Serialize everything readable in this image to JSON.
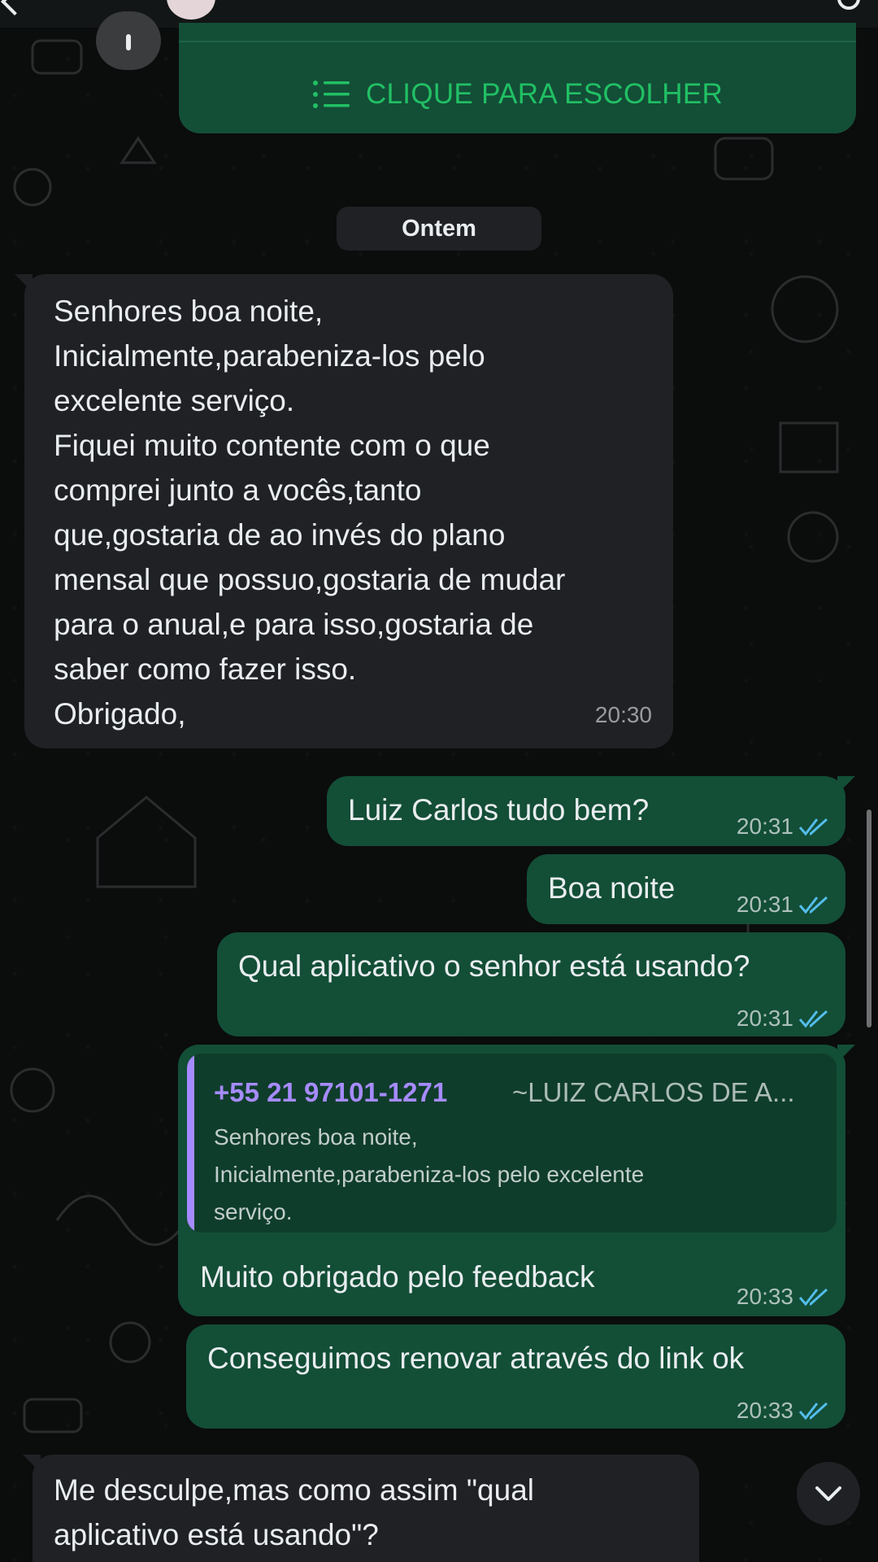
{
  "conversation": {
    "list_button_label": "CLIQUE PARA ESCOLHER",
    "date_divider": "Ontem",
    "messages": [
      {
        "direction": "incoming",
        "text": "Senhores boa noite,\nInicialmente,parabeniza-los pelo\nexcelente serviço.\nFiquei muito contente com o que\ncomprei junto a vocês,tanto\nque,gostaria de ao invés do plano\nmensal que possuo,gostaria de mudar\npara o anual,e para isso,gostaria de\nsaber como fazer isso.\nObrigado,",
        "time": "20:30"
      },
      {
        "direction": "outgoing",
        "text": "Luiz Carlos tudo bem?",
        "time": "20:31",
        "status": "read"
      },
      {
        "direction": "outgoing",
        "text": "Boa noite",
        "time": "20:31",
        "status": "read"
      },
      {
        "direction": "outgoing",
        "text": "Qual aplicativo o senhor está usando?",
        "time": "20:31",
        "status": "read"
      },
      {
        "direction": "outgoing",
        "reply_to": {
          "author": "+55 21 97101-1271",
          "push_name": "~LUIZ CARLOS DE A...",
          "text": "Senhores boa noite,\nInicialmente,parabeniza-los pelo excelente\nserviço."
        },
        "text": "Muito obrigado pelo feedback",
        "time": "20:33",
        "status": "read"
      },
      {
        "direction": "outgoing",
        "text": "Conseguimos renovar através do link ok",
        "time": "20:33",
        "status": "read"
      },
      {
        "direction": "incoming",
        "text": "Me desculpe,mas como assim \"qual\naplicativo está usando\"?"
      }
    ]
  },
  "icons": {
    "list": "list-icon",
    "read_receipt": "double-check-icon",
    "scroll_down": "chevron-down-icon"
  },
  "colors": {
    "outgoing_bubble": "#134e37",
    "incoming_bubble": "#1f2124",
    "read_ticks": "#53bdeb",
    "accent_green": "#21c064",
    "quote_author": "#a68bff"
  }
}
